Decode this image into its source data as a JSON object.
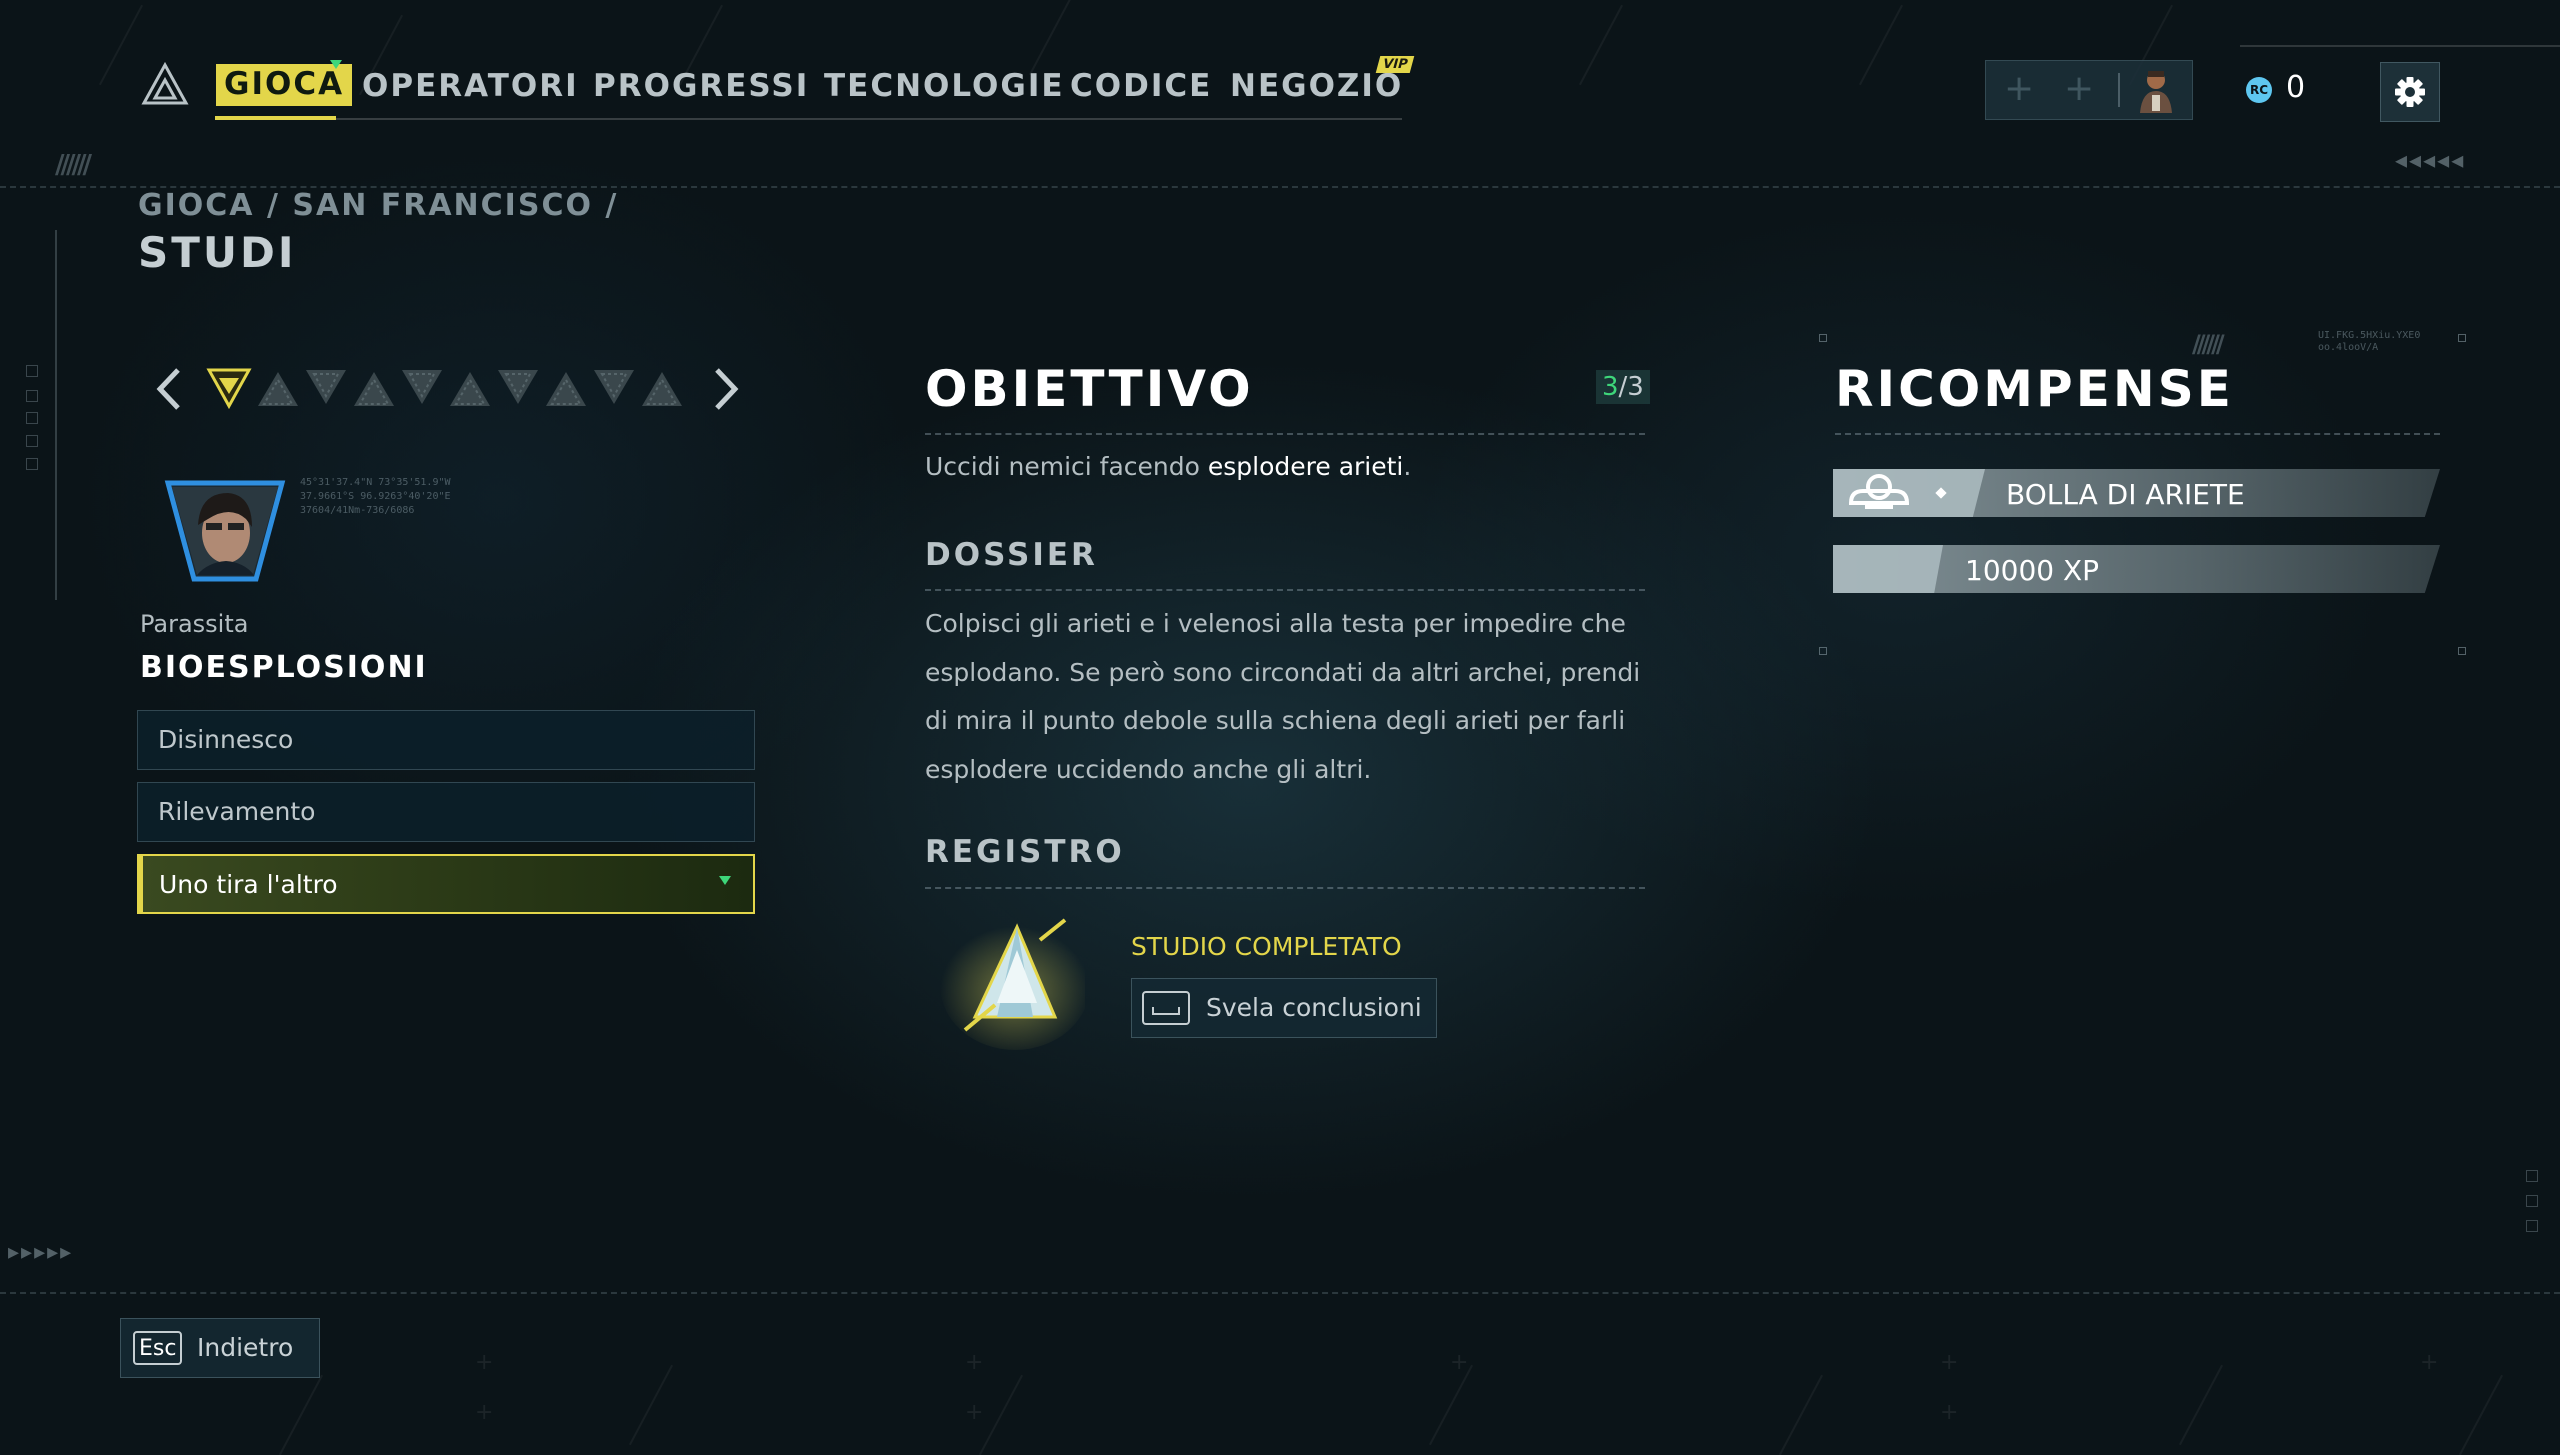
{
  "nav": {
    "items": [
      {
        "label": "GIOCA",
        "active": true
      },
      {
        "label": "OPERATORI"
      },
      {
        "label": "PROGRESSI"
      },
      {
        "label": "TECNOLOGIE"
      },
      {
        "label": "CODICE"
      },
      {
        "label": "NEGOZIO"
      }
    ],
    "vip_badge": "VIP"
  },
  "header_right": {
    "currency_icon": "RC",
    "currency_value": "0"
  },
  "breadcrumb": "GIOCA / SAN FRANCISCO /",
  "page_title": "STUDI",
  "left_panel": {
    "category": "Parassita",
    "section_title": "BIOESPLOSIONI",
    "studies": [
      {
        "label": "Disinnesco"
      },
      {
        "label": "Rilevamento"
      },
      {
        "label": "Uno tira l'altro",
        "selected": true
      }
    ],
    "coords": [
      "45°31'37.4\"N 73°35'51.9\"W",
      "37.9661°S 96.9263°40'20\"E",
      "37604/41Nm-736/6086"
    ]
  },
  "objective": {
    "title": "OBIETTIVO",
    "count_current": "3",
    "count_total": "/3",
    "text_before": "Uccidi nemici facendo ",
    "text_highlight": "esplodere arieti",
    "text_after": "."
  },
  "dossier": {
    "title": "DOSSIER",
    "text": "Colpisci gli arieti e i velenosi alla testa per impedire che esplodano. Se però sono circondati da altri archei, prendi di mira il punto debole sulla schiena degli arieti per farli esplodere uccidendo anche gli altri."
  },
  "registro": {
    "title": "REGISTRO",
    "status": "STUDIO COMPLETATO",
    "reveal_label": "Svela conclusioni"
  },
  "rewards": {
    "title": "RICOMPENSE",
    "items": [
      {
        "label": "BOLLA DI ARIETE",
        "icon": "bubble-icon"
      },
      {
        "label": "10000 XP"
      }
    ],
    "code": [
      "UI.FKG.5HXiu.YXE0",
      "oo.4looV/A"
    ]
  },
  "footer": {
    "back_key": "Esc",
    "back_label": "Indietro"
  },
  "colors": {
    "accent_yellow": "#e3d64a",
    "accent_green": "#3ed67a",
    "bg": "#0b1418"
  }
}
